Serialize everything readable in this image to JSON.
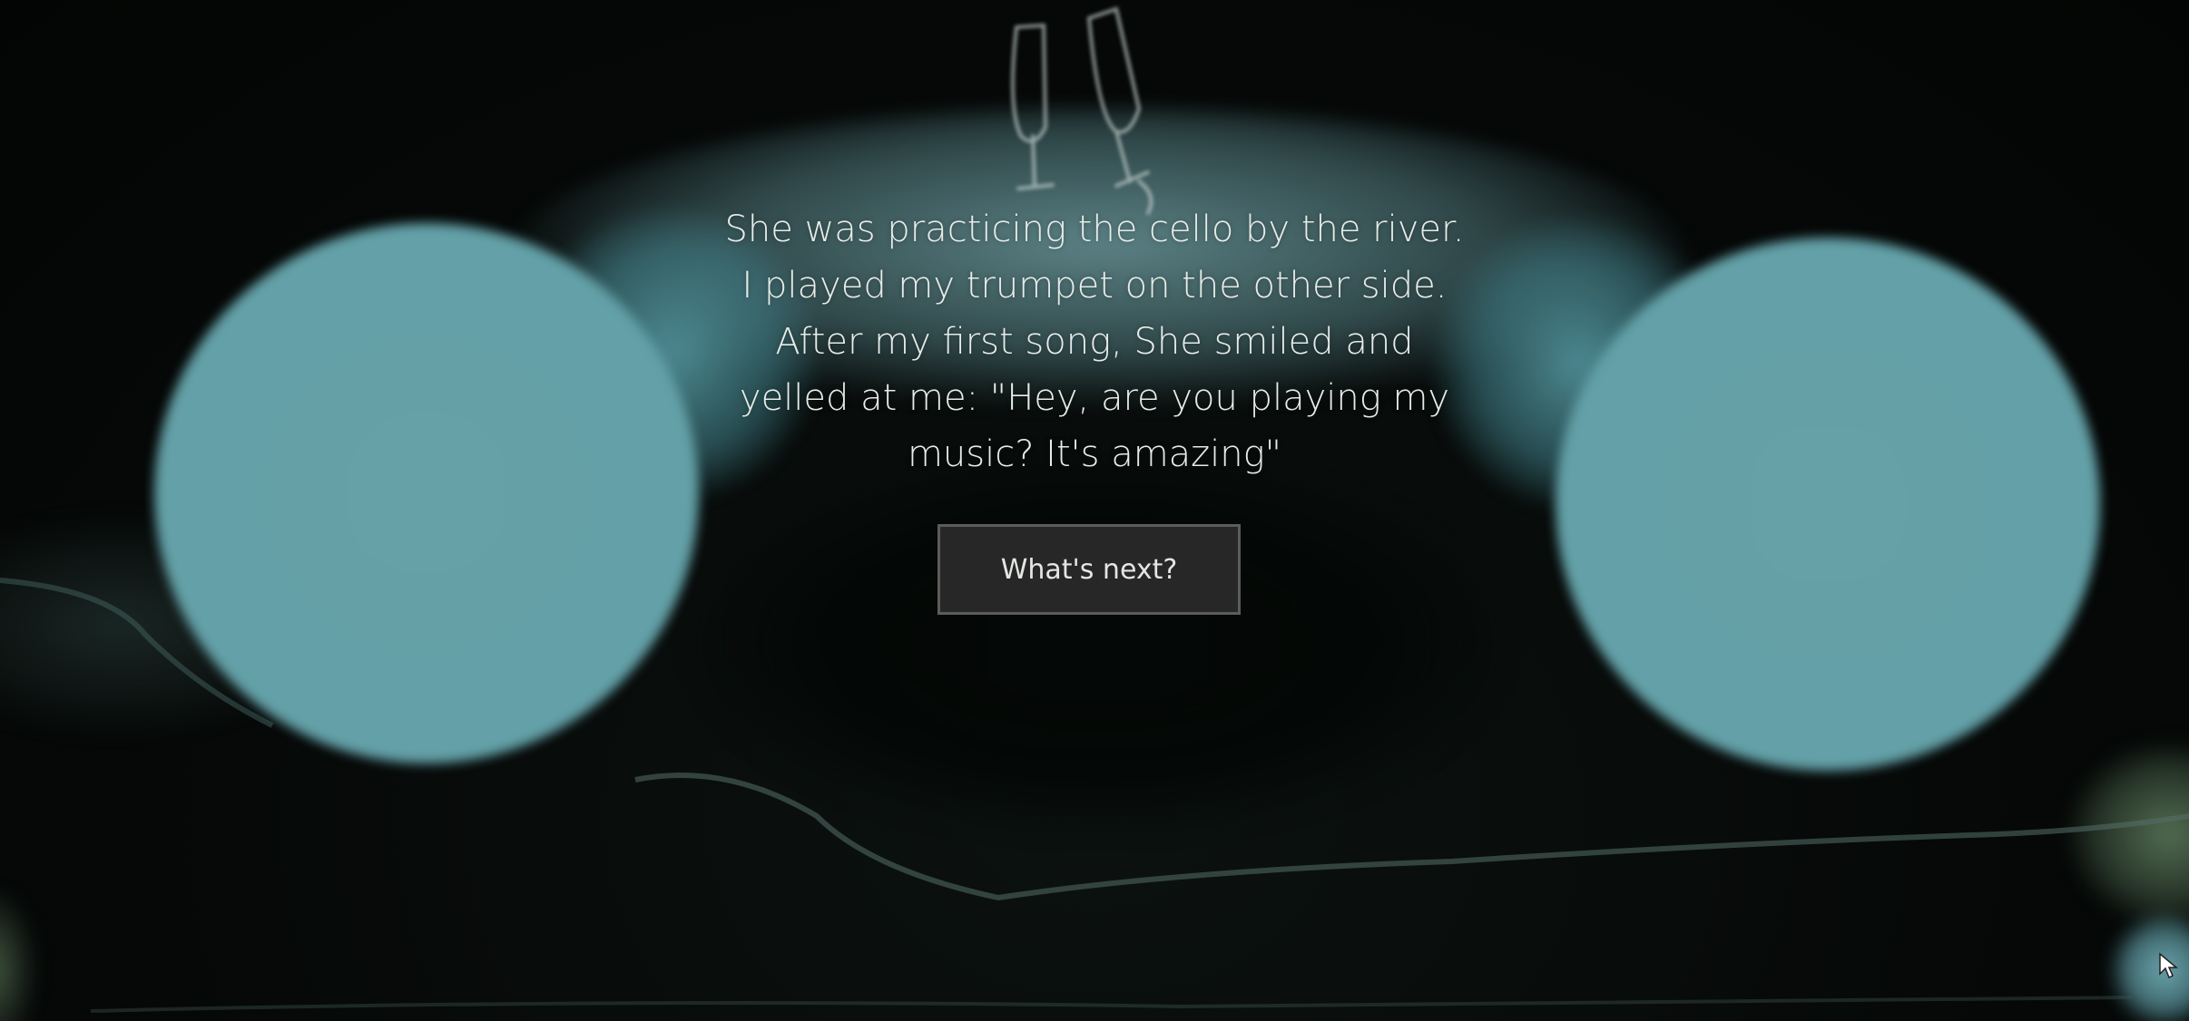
{
  "story": {
    "lines": [
      "She was practicing the cello by the river.",
      "I played my trumpet on the other side.",
      "After my first song, She smiled and",
      "yelled at me: \"Hey, are you playing my",
      "music? It's amazing\""
    ]
  },
  "actions": {
    "next_label": "What's next?"
  },
  "colors": {
    "background": "#050807",
    "lens": "#63a0a7",
    "text": "#e6ece9",
    "button_bg": "#262726",
    "button_border": "#5c5d5b",
    "grass": "#6e8f6c"
  },
  "icons": {
    "pointer": "mouse-pointer-icon"
  }
}
